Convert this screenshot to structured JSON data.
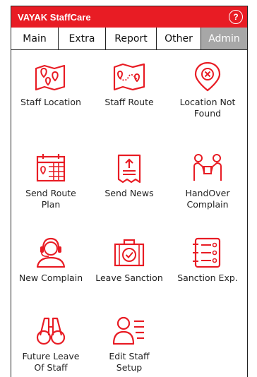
{
  "app": {
    "title": "VAYAK StaffCare",
    "help_glyph": "?"
  },
  "colors": {
    "accent": "#e81c24",
    "active_tab": "#a7a7a7"
  },
  "tabs": [
    {
      "label": "Main"
    },
    {
      "label": "Extra"
    },
    {
      "label": "Report"
    },
    {
      "label": "Other"
    },
    {
      "label": "Admin",
      "active": true
    }
  ],
  "tiles": [
    {
      "label_lines": [
        "Staff Location"
      ],
      "icon": "map-pins-icon"
    },
    {
      "label_lines": [
        "Staff Route"
      ],
      "icon": "route-map-icon"
    },
    {
      "label_lines": [
        "Location Not",
        "Found"
      ],
      "icon": "location-not-found-icon"
    },
    {
      "label_lines": [
        "Send Route",
        "Plan"
      ],
      "icon": "calendar-icon"
    },
    {
      "label_lines": [
        "Send News"
      ],
      "icon": "news-upload-icon"
    },
    {
      "label_lines": [
        "HandOver",
        "Complain"
      ],
      "icon": "handover-icon"
    },
    {
      "label_lines": [
        "New Complain"
      ],
      "icon": "support-agent-icon"
    },
    {
      "label_lines": [
        "Leave Sanction"
      ],
      "icon": "briefcase-check-icon"
    },
    {
      "label_lines": [
        "Sanction Exp."
      ],
      "icon": "checklist-icon"
    },
    {
      "label_lines": [
        "Future Leave",
        "Of Staff"
      ],
      "icon": "binoculars-icon"
    },
    {
      "label_lines": [
        "Edit Staff",
        "Setup"
      ],
      "icon": "user-list-icon"
    }
  ]
}
